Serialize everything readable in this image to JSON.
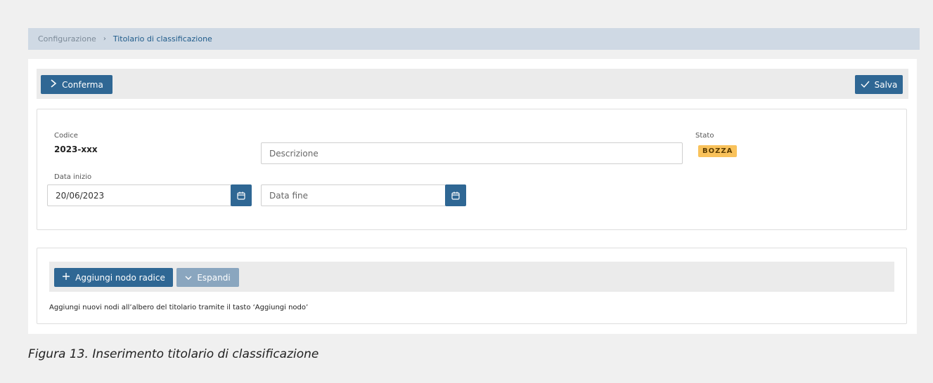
{
  "breadcrumb": {
    "parent": "Configurazione",
    "separator": "›",
    "current": "Titolario di classificazione"
  },
  "toolbar": {
    "confirm_label": "Conferma",
    "save_label": "Salva"
  },
  "form": {
    "codice_label": "Codice",
    "codice_value": "2023-xxx",
    "descrizione_placeholder": "Descrizione",
    "stato_label": "Stato",
    "stato_value": "BOZZA",
    "data_inizio_label": "Data inizio",
    "data_inizio_value": "20/06/2023",
    "data_fine_placeholder": "Data fine"
  },
  "tree": {
    "add_root_label": "Aggiungi nodo radice",
    "expand_label": "Espandi",
    "hint": "Aggiungi nuovi nodi all’albero del titolario tramite il tasto ‘Aggiungi nodo’"
  },
  "caption": "Figura 13. Inserimento titolario di classificazione",
  "colors": {
    "primary": "#2f6794",
    "disabled": "#8aa6bf",
    "badge": "#f9c25b",
    "breadcrumb_bg": "#cfd9e4"
  },
  "icons": {
    "confirm": "chevron-right-icon",
    "save": "check-icon",
    "calendar": "calendar-icon",
    "add": "plus-icon",
    "expand": "chevron-down-icon"
  }
}
